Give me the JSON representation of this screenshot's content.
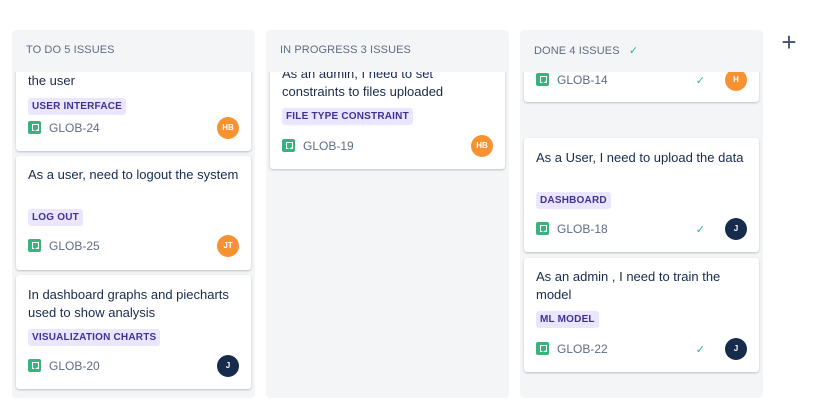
{
  "board": {
    "add_column_symbol": "+",
    "columns": [
      {
        "header": "TO DO 5 ISSUES",
        "cards": [
          {
            "title": "the user",
            "label": "USER INTERFACE",
            "key": "GLOB-24",
            "avatar": "HB",
            "avatar_color": "#f79232"
          },
          {
            "title": "As a user, need to logout the system",
            "label": "LOG OUT",
            "key": "GLOB-25",
            "avatar": "JT",
            "avatar_color": "#f79232"
          },
          {
            "title": "In dashboard graphs and piecharts used to show analysis",
            "label": "VISUALIZATION CHARTS",
            "key": "GLOB-20",
            "avatar": "J",
            "avatar_color": "#172b4d"
          }
        ]
      },
      {
        "header": "IN PROGRESS 3 ISSUES",
        "cards": [
          {
            "title": "As an admin, I need to set constraints to files uploaded",
            "label": "FILE TYPE CONSTRAINT",
            "key": "GLOB-19",
            "avatar": "HB",
            "avatar_color": "#f79232"
          }
        ]
      },
      {
        "header": "DONE 4 ISSUES",
        "header_check": "✓",
        "cards": [
          {
            "title": "",
            "label": "",
            "key": "GLOB-14",
            "done_check": "✓",
            "avatar": "H",
            "avatar_color": "#f79232"
          },
          {
            "title": "As a User, I need to upload the data",
            "label": "DASHBOARD",
            "key": "GLOB-18",
            "done_check": "✓",
            "avatar": "J",
            "avatar_color": "#172b4d"
          },
          {
            "title": "As an admin , I need to train the model",
            "label": "ML MODEL",
            "key": "GLOB-22",
            "done_check": "✓",
            "avatar": "J",
            "avatar_color": "#172b4d"
          }
        ]
      }
    ]
  },
  "icons": {
    "story": "story-icon",
    "check": "check-icon",
    "add": "plus-icon"
  }
}
